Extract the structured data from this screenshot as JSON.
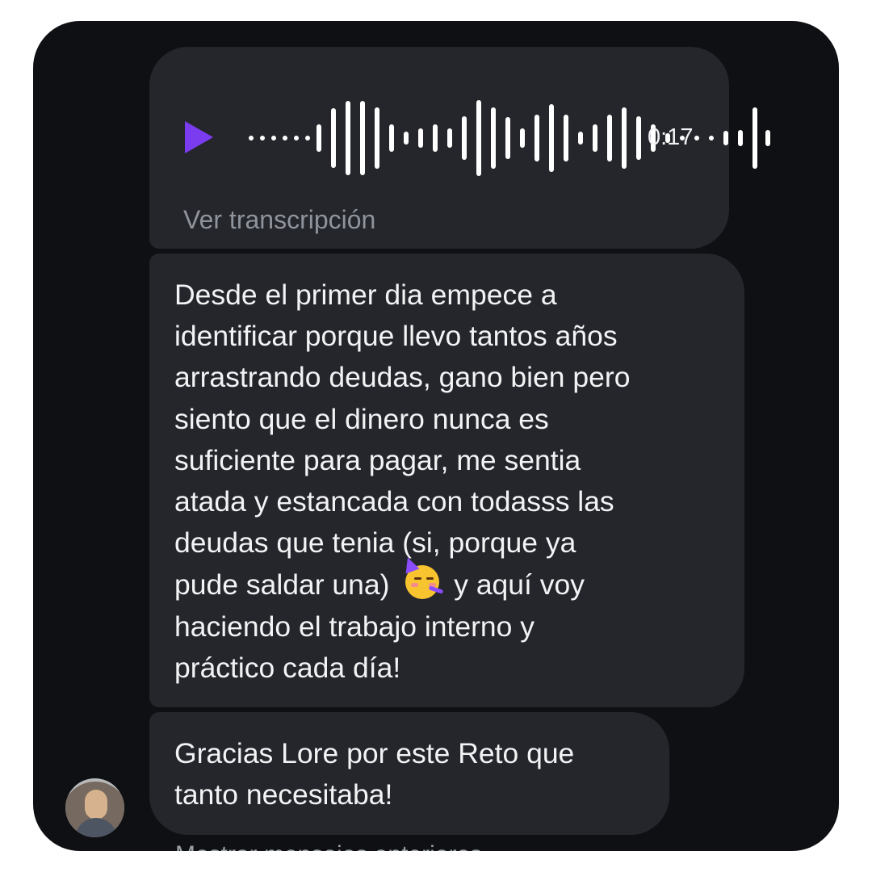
{
  "conversation": {
    "voice_message": {
      "duration": "0:17",
      "transcript_link": "Ver transcripción",
      "icon": "play-icon",
      "accent": "#7b3cf0"
    },
    "messages": [
      {
        "text_before_emoji": "Desde el primer dia empece a\nidentificar porque llevo tantos años\narrastrando deudas, gano bien pero\nsiento que el dinero nunca es\nsuficiente para pagar, me sentia\natada y estancada con todasss las\ndeudas que tenia (si, porque ya\npude saldar una)",
        "emoji": "🥳",
        "text_after_emoji": "y aquí voy\nhaciendo el trabajo interno y\npráctico cada día!"
      },
      {
        "text": "Gracias Lore por este Reto que\ntanto necesitaba!"
      }
    ],
    "partial_footer": "Mostrar mensajes anteriores"
  }
}
